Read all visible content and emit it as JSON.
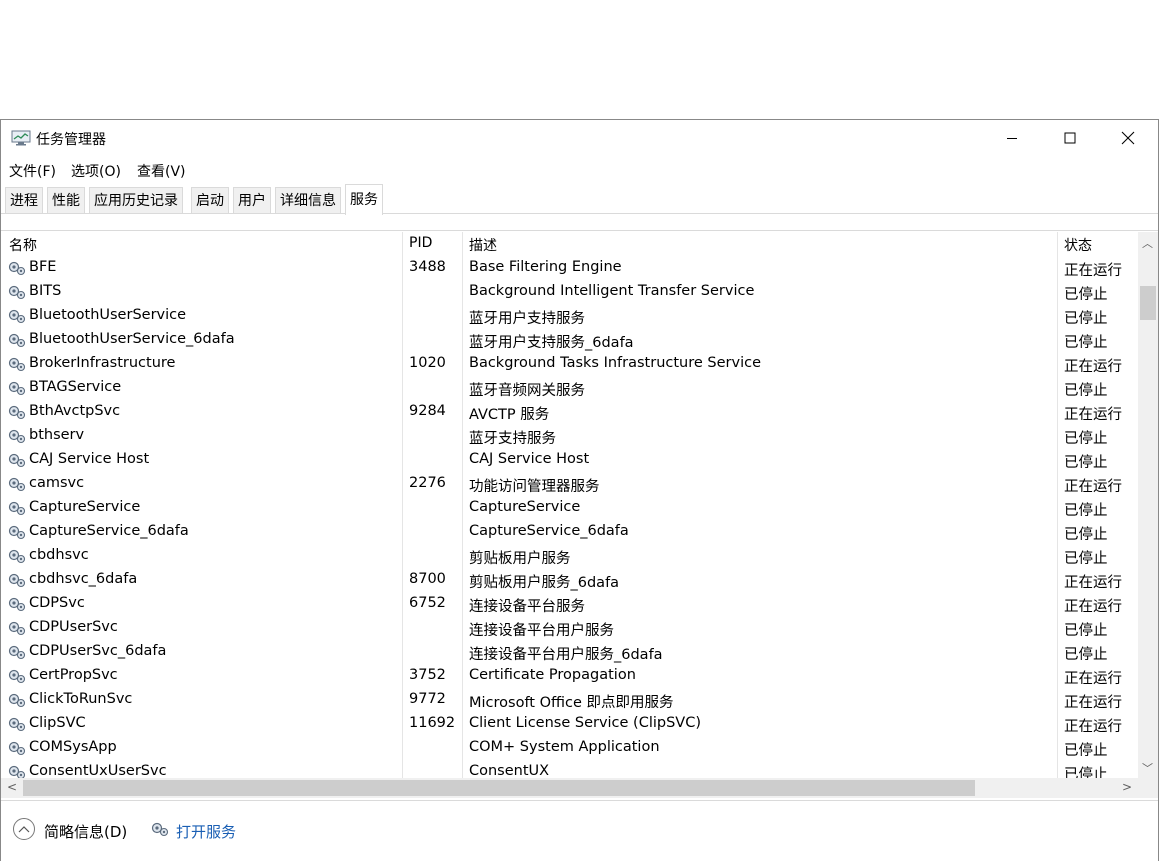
{
  "window": {
    "title": "任务管理器"
  },
  "menu": [
    "文件(F)",
    "选项(O)",
    "查看(V)"
  ],
  "tabs": [
    {
      "label": "进程",
      "active": false
    },
    {
      "label": "性能",
      "active": false
    },
    {
      "label": "应用历史记录",
      "active": false
    },
    {
      "label": "启动",
      "active": false
    },
    {
      "label": "用户",
      "active": false
    },
    {
      "label": "详细信息",
      "active": false
    },
    {
      "label": "服务",
      "active": true
    }
  ],
  "columns": {
    "name": "名称",
    "pid": "PID",
    "desc": "描述",
    "status": "状态"
  },
  "rows": [
    {
      "name": "BFE",
      "pid": "3488",
      "desc": "Base Filtering Engine",
      "status": "正在运行"
    },
    {
      "name": "BITS",
      "pid": "",
      "desc": "Background Intelligent Transfer Service",
      "status": "已停止"
    },
    {
      "name": "BluetoothUserService",
      "pid": "",
      "desc": "蓝牙用户支持服务",
      "status": "已停止"
    },
    {
      "name": "BluetoothUserService_6dafa",
      "pid": "",
      "desc": "蓝牙用户支持服务_6dafa",
      "status": "已停止"
    },
    {
      "name": "BrokerInfrastructure",
      "pid": "1020",
      "desc": "Background Tasks Infrastructure Service",
      "status": "正在运行"
    },
    {
      "name": "BTAGService",
      "pid": "",
      "desc": "蓝牙音频网关服务",
      "status": "已停止"
    },
    {
      "name": "BthAvctpSvc",
      "pid": "9284",
      "desc": "AVCTP 服务",
      "status": "正在运行"
    },
    {
      "name": "bthserv",
      "pid": "",
      "desc": "蓝牙支持服务",
      "status": "已停止"
    },
    {
      "name": "CAJ Service Host",
      "pid": "",
      "desc": "CAJ Service Host",
      "status": "已停止"
    },
    {
      "name": "camsvc",
      "pid": "2276",
      "desc": "功能访问管理器服务",
      "status": "正在运行"
    },
    {
      "name": "CaptureService",
      "pid": "",
      "desc": "CaptureService",
      "status": "已停止"
    },
    {
      "name": "CaptureService_6dafa",
      "pid": "",
      "desc": "CaptureService_6dafa",
      "status": "已停止"
    },
    {
      "name": "cbdhsvc",
      "pid": "",
      "desc": "剪贴板用户服务",
      "status": "已停止"
    },
    {
      "name": "cbdhsvc_6dafa",
      "pid": "8700",
      "desc": "剪贴板用户服务_6dafa",
      "status": "正在运行"
    },
    {
      "name": "CDPSvc",
      "pid": "6752",
      "desc": "连接设备平台服务",
      "status": "正在运行"
    },
    {
      "name": "CDPUserSvc",
      "pid": "",
      "desc": "连接设备平台用户服务",
      "status": "已停止"
    },
    {
      "name": "CDPUserSvc_6dafa",
      "pid": "",
      "desc": "连接设备平台用户服务_6dafa",
      "status": "已停止"
    },
    {
      "name": "CertPropSvc",
      "pid": "3752",
      "desc": "Certificate Propagation",
      "status": "正在运行"
    },
    {
      "name": "ClickToRunSvc",
      "pid": "9772",
      "desc": "Microsoft Office 即点即用服务",
      "status": "正在运行"
    },
    {
      "name": "ClipSVC",
      "pid": "11692",
      "desc": "Client License Service (ClipSVC)",
      "status": "正在运行"
    },
    {
      "name": "COMSysApp",
      "pid": "",
      "desc": "COM+ System Application",
      "status": "已停止"
    },
    {
      "name": "ConsentUxUserSvc",
      "pid": "",
      "desc": "ConsentUX",
      "status": "已停止"
    }
  ],
  "footer": {
    "brief": "简略信息(D)",
    "open_services": "打开服务"
  },
  "icons": {
    "app": "task-manager-icon",
    "service": "service-gear-icon",
    "collapse": "chevron-up-icon"
  }
}
